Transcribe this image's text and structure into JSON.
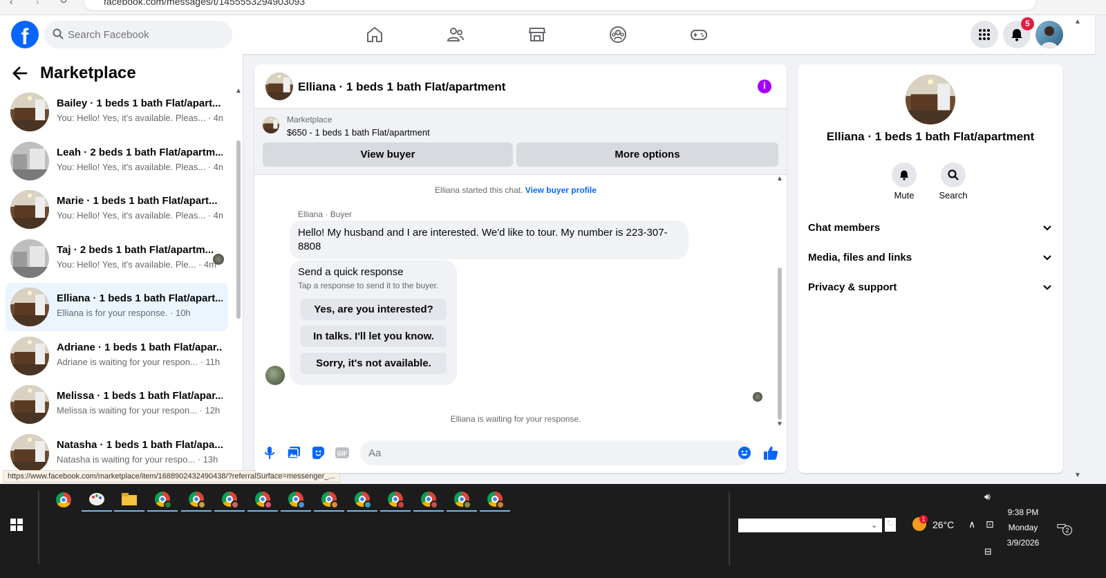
{
  "browser": {
    "url": "facebook.com/messages/t/1455553294903093"
  },
  "header": {
    "search_placeholder": "Search Facebook",
    "notification_count": "5",
    "nav_icons": [
      "home-icon",
      "friends-icon",
      "marketplace-icon",
      "groups-icon",
      "gaming-icon"
    ]
  },
  "sidebar": {
    "title": "Marketplace",
    "conversations": [
      {
        "name": "Bailey · 1 beds 1 bath Flat/apart...",
        "preview": "You: Hello! Yes, it's available. Pleas... · 4m"
      },
      {
        "name": "Leah · 2 beds 1 bath Flat/apartm...",
        "preview": "You: Hello! Yes, it's available. Pleas... · 4m"
      },
      {
        "name": "Marie · 1 beds 1 bath Flat/apart...",
        "preview": "You: Hello! Yes, it's available. Pleas... · 4m"
      },
      {
        "name": "Taj · 2 beds 1 bath Flat/apartm...",
        "preview": "You: Hello! Yes, it's available. Ple... · 4m"
      },
      {
        "name": "Elliana · 1 beds 1 bath Flat/apart...",
        "preview": "Elliana is for your response. · 10h"
      },
      {
        "name": "Adriane · 1 beds 1 bath Flat/apar...",
        "preview": "Adriane is waiting for your respon... · 11h"
      },
      {
        "name": "Melissa · 1 beds 1 bath Flat/apar...",
        "preview": "Melissa is waiting for your respon... · 12h"
      },
      {
        "name": "Natasha · 1 beds 1 bath Flat/apa...",
        "preview": "Natasha is waiting for your respo... · 13h"
      }
    ]
  },
  "status_url": "https://www.facebook.com/marketplace/item/1688902432490438/?referralSurface=messenger_...",
  "chat": {
    "title": "Elliana · 1 beds 1 bath Flat/apartment",
    "marketplace_label": "Marketplace",
    "listing": "$650 - 1 beds 1 bath Flat/apartment",
    "view_buyer": "View buyer",
    "more_options": "More options",
    "started_text": "Elliana started this chat.",
    "view_buyer_profile": "View buyer profile",
    "sender_label": "Elliana · Buyer",
    "message": "Hello! My husband and I are interested. We'd like to tour. My number is 223-307-8808",
    "quick_title": "Send a quick response",
    "quick_sub": "Tap a response to send it to the buyer.",
    "quick_responses": [
      "Yes, are you interested?",
      "In talks. I'll let you know.",
      "Sorry, it's not available."
    ],
    "waiting_text": "Elliana is waiting for your response.",
    "input_placeholder": "Aa"
  },
  "details": {
    "title": "Elliana · 1 beds 1 bath Flat/apartment",
    "mute": "Mute",
    "search": "Search",
    "sections": [
      "Chat members",
      "Media, files and links",
      "Privacy & support"
    ]
  },
  "taskbar": {
    "temperature": "26°C",
    "weather_badge": "1",
    "time": "9:38 PM",
    "day": "Monday",
    "date": "3/9/2026",
    "notif_count": "2"
  }
}
